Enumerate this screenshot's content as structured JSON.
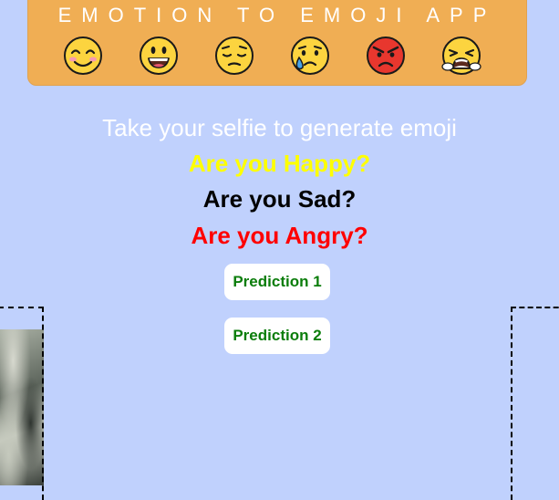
{
  "header": {
    "title": "EMOTION TO EMOJI APP",
    "emojis": [
      "smiling-face-icon",
      "grinning-face-icon",
      "pensive-face-icon",
      "crying-face-icon",
      "angry-face-icon",
      "tired-face-icon"
    ],
    "background_color": "#f0ae54"
  },
  "main": {
    "subtitle": "Take your selfie to generate emoji",
    "questions": {
      "happy": "Are you Happy?",
      "sad": "Are you Sad?",
      "angry": "Are you Angry?"
    },
    "buttons": {
      "prediction_1": "Prediction 1",
      "prediction_2": "Prediction 2"
    }
  },
  "colors": {
    "page_background": "#c0d1fd",
    "happy": "#ffff00",
    "sad": "#000000",
    "angry": "#ff0000",
    "button_text": "#0b7d0b"
  }
}
